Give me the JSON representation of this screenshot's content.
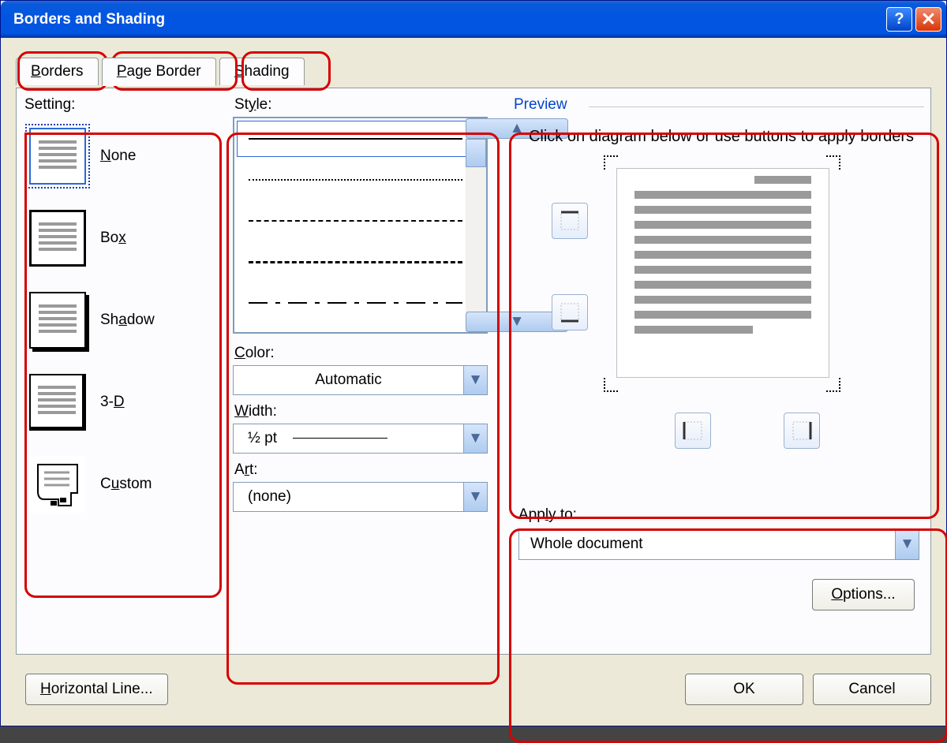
{
  "title": "Borders and Shading",
  "tabs": {
    "borders": "Borders",
    "page_border": "Page Border",
    "shading": "Shading"
  },
  "setting": {
    "label": "Setting:",
    "items": [
      {
        "label": "None"
      },
      {
        "label": "Box"
      },
      {
        "label": "Shadow"
      },
      {
        "label": "3-D"
      },
      {
        "label": "Custom"
      }
    ]
  },
  "style": {
    "label": "Style:"
  },
  "color": {
    "label": "Color:",
    "value": "Automatic"
  },
  "width": {
    "label": "Width:",
    "value": "½ pt"
  },
  "art": {
    "label": "Art:",
    "value": "(none)"
  },
  "preview": {
    "label": "Preview",
    "hint": "Click on diagram below or use buttons to apply borders"
  },
  "apply": {
    "label": "Apply to:",
    "value": "Whole document"
  },
  "buttons": {
    "options": "Options...",
    "hline": "Horizontal Line...",
    "ok": "OK",
    "cancel": "Cancel"
  }
}
